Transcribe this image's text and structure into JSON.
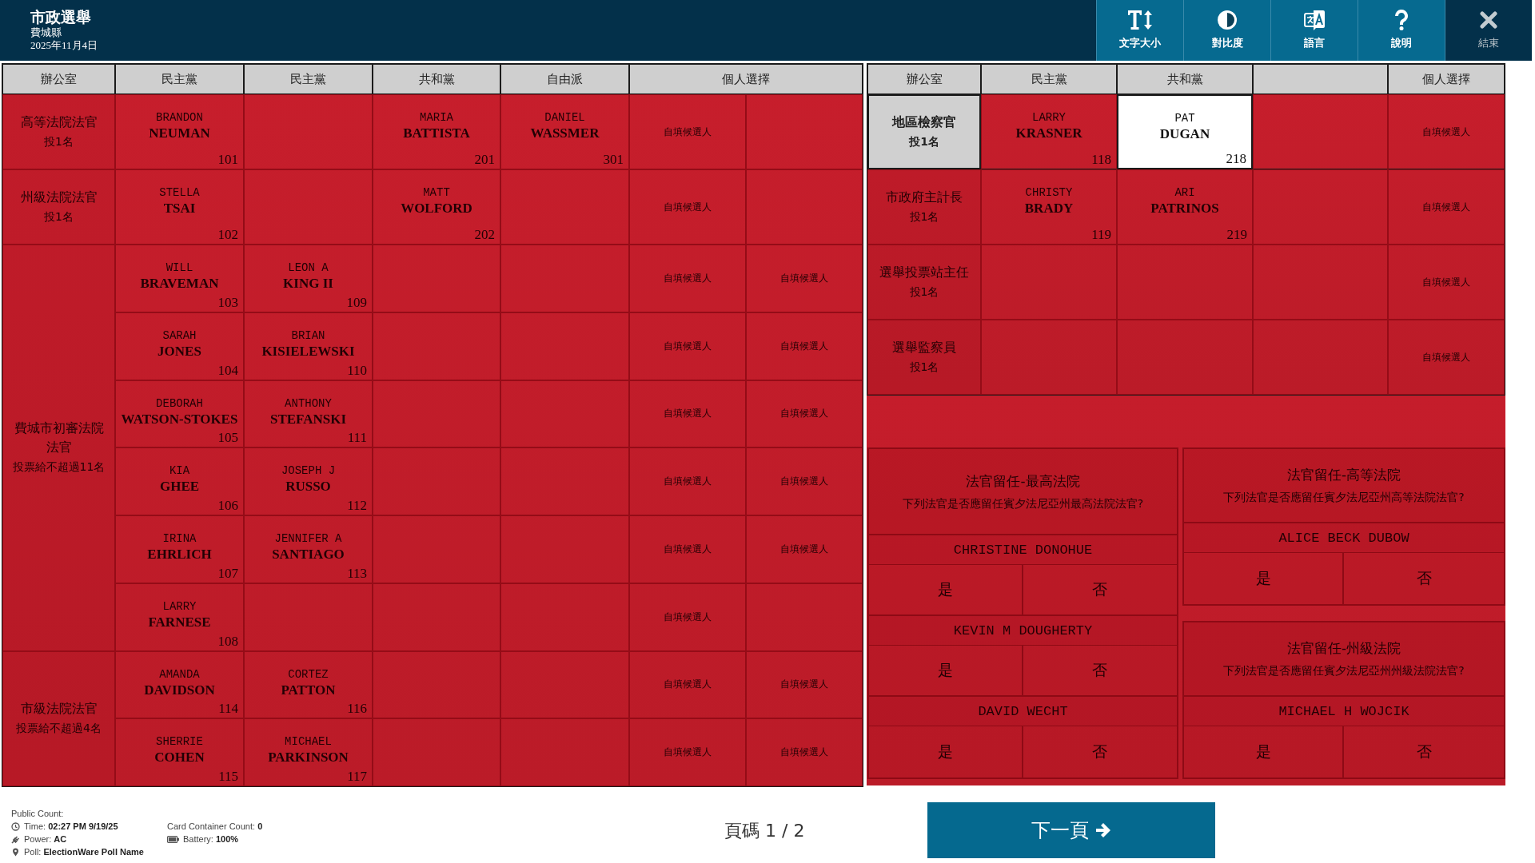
{
  "header": {
    "title": "市政選舉",
    "county": "費城縣",
    "date": "2025年11月4日"
  },
  "toolbar": [
    {
      "kind": "text-size",
      "label": "文字大小"
    },
    {
      "kind": "contrast",
      "label": "對比度"
    },
    {
      "kind": "language",
      "label": "語言"
    },
    {
      "kind": "help",
      "label": "說明"
    },
    {
      "kind": "exit",
      "label": "結束"
    }
  ],
  "left_table": {
    "columns": [
      {
        "label": "辦公室"
      },
      {
        "label": "民主黨"
      },
      {
        "label": "民主黨"
      },
      {
        "label": "共和黨"
      },
      {
        "label": "自由派"
      },
      {
        "label": "個人選擇"
      }
    ],
    "contests": [
      {
        "office": "高等法院法官",
        "limit": "投1名",
        "focused": false,
        "rows": [
          {
            "cells": [
              {
                "kind": "candidate",
                "first": "BRANDON",
                "last": "NEUMAN",
                "number": "101",
                "focused": false
              },
              {
                "kind": "empty"
              },
              {
                "kind": "candidate",
                "first": "MARIA",
                "last": "BATTISTA",
                "number": "201",
                "focused": false
              },
              {
                "kind": "candidate",
                "first": "DANIEL",
                "last": "WASSMER",
                "number": "301",
                "focused": false
              },
              {
                "kind": "write-in",
                "label": "自填候選人"
              },
              {
                "kind": "empty"
              }
            ]
          }
        ]
      },
      {
        "office": "州級法院法官",
        "limit": "投1名",
        "focused": false,
        "rows": [
          {
            "cells": [
              {
                "kind": "candidate",
                "first": "STELLA",
                "last": "TSAI",
                "number": "102",
                "focused": false
              },
              {
                "kind": "empty"
              },
              {
                "kind": "candidate",
                "first": "MATT",
                "last": "WOLFORD",
                "number": "202",
                "focused": false
              },
              {
                "kind": "empty"
              },
              {
                "kind": "write-in",
                "label": "自填候選人"
              },
              {
                "kind": "empty"
              }
            ]
          }
        ]
      },
      {
        "office": "費城市初審法院法官",
        "limit": "投票給不超過11名",
        "focused": false,
        "rows": [
          {
            "cells": [
              {
                "kind": "candidate",
                "first": "WILL",
                "last": "BRAVEMAN",
                "number": "103",
                "focused": false
              },
              {
                "kind": "candidate",
                "first": "LEON A",
                "last": "KING II",
                "number": "109",
                "focused": false
              },
              {
                "kind": "empty"
              },
              {
                "kind": "empty"
              },
              {
                "kind": "write-in",
                "label": "自填候選人"
              },
              {
                "kind": "write-in",
                "label": "自填候選人"
              }
            ]
          },
          {
            "cells": [
              {
                "kind": "candidate",
                "first": "SARAH",
                "last": "JONES",
                "number": "104",
                "focused": false
              },
              {
                "kind": "candidate",
                "first": "BRIAN",
                "last": "KISIELEWSKI",
                "number": "110",
                "focused": false
              },
              {
                "kind": "empty"
              },
              {
                "kind": "empty"
              },
              {
                "kind": "write-in",
                "label": "自填候選人"
              },
              {
                "kind": "write-in",
                "label": "自填候選人"
              }
            ]
          },
          {
            "cells": [
              {
                "kind": "candidate",
                "first": "DEBORAH",
                "last": "WATSON-STOKES",
                "number": "105",
                "focused": false
              },
              {
                "kind": "candidate",
                "first": "ANTHONY",
                "last": "STEFANSKI",
                "number": "111",
                "focused": false
              },
              {
                "kind": "empty"
              },
              {
                "kind": "empty"
              },
              {
                "kind": "write-in",
                "label": "自填候選人"
              },
              {
                "kind": "write-in",
                "label": "自填候選人"
              }
            ]
          },
          {
            "cells": [
              {
                "kind": "candidate",
                "first": "KIA",
                "last": "GHEE",
                "number": "106",
                "focused": false
              },
              {
                "kind": "candidate",
                "first": "JOSEPH J",
                "last": "RUSSO",
                "number": "112",
                "focused": false
              },
              {
                "kind": "empty"
              },
              {
                "kind": "empty"
              },
              {
                "kind": "write-in",
                "label": "自填候選人"
              },
              {
                "kind": "write-in",
                "label": "自填候選人"
              }
            ]
          },
          {
            "cells": [
              {
                "kind": "candidate",
                "first": "IRINA",
                "last": "EHRLICH",
                "number": "107",
                "focused": false
              },
              {
                "kind": "candidate",
                "first": "JENNIFER A",
                "last": "SANTIAGO",
                "number": "113",
                "focused": false
              },
              {
                "kind": "empty"
              },
              {
                "kind": "empty"
              },
              {
                "kind": "write-in",
                "label": "自填候選人"
              },
              {
                "kind": "write-in",
                "label": "自填候選人"
              }
            ]
          },
          {
            "cells": [
              {
                "kind": "candidate",
                "first": "LARRY",
                "last": "FARNESE",
                "number": "108",
                "focused": false
              },
              {
                "kind": "empty"
              },
              {
                "kind": "empty"
              },
              {
                "kind": "empty"
              },
              {
                "kind": "write-in",
                "label": "自填候選人"
              },
              {
                "kind": "empty"
              }
            ]
          }
        ]
      },
      {
        "office": "市級法院法官",
        "limit": "投票給不超過4名",
        "focused": false,
        "rows": [
          {
            "cells": [
              {
                "kind": "candidate",
                "first": "AMANDA",
                "last": "DAVIDSON",
                "number": "114",
                "focused": false
              },
              {
                "kind": "candidate",
                "first": "CORTEZ",
                "last": "PATTON",
                "number": "116",
                "focused": false
              },
              {
                "kind": "empty"
              },
              {
                "kind": "empty"
              },
              {
                "kind": "write-in",
                "label": "自填候選人"
              },
              {
                "kind": "write-in",
                "label": "自填候選人"
              }
            ]
          },
          {
            "cells": [
              {
                "kind": "candidate",
                "first": "SHERRIE",
                "last": "COHEN",
                "number": "115",
                "focused": false
              },
              {
                "kind": "candidate",
                "first": "MICHAEL",
                "last": "PARKINSON",
                "number": "117",
                "focused": false
              },
              {
                "kind": "empty"
              },
              {
                "kind": "empty"
              },
              {
                "kind": "write-in",
                "label": "自填候選人"
              },
              {
                "kind": "write-in",
                "label": "自填候選人"
              }
            ]
          }
        ]
      }
    ]
  },
  "right_table": {
    "columns": [
      {
        "label": "辦公室"
      },
      {
        "label": "民主黨"
      },
      {
        "label": "共和黨"
      },
      {},
      {
        "label": "個人選擇"
      }
    ],
    "contests": [
      {
        "office": "地區檢察官",
        "limit": "投1名",
        "focused": true,
        "rows": [
          {
            "cells": [
              {
                "kind": "candidate",
                "first": "LARRY",
                "last": "KRASNER",
                "number": "118",
                "focused": false
              },
              {
                "kind": "candidate",
                "first": "PAT",
                "last": "DUGAN",
                "number": "218",
                "focused": true
              },
              {
                "kind": "empty"
              },
              {
                "kind": "write-in",
                "label": "自填候選人"
              }
            ]
          }
        ]
      },
      {
        "office": "市政府主計長",
        "limit": "投1名",
        "focused": false,
        "rows": [
          {
            "cells": [
              {
                "kind": "candidate",
                "first": "CHRISTY",
                "last": "BRADY",
                "number": "119",
                "focused": false
              },
              {
                "kind": "candidate",
                "first": "ARI",
                "last": "PATRINOS",
                "number": "219",
                "focused": false
              },
              {
                "kind": "empty"
              },
              {
                "kind": "write-in",
                "label": "自填候選人"
              }
            ]
          }
        ]
      },
      {
        "office": "選舉投票站主任",
        "limit": "投1名",
        "focused": false,
        "rows": [
          {
            "cells": [
              {
                "kind": "empty"
              },
              {
                "kind": "empty"
              },
              {
                "kind": "empty"
              },
              {
                "kind": "write-in",
                "label": "自填候選人"
              }
            ]
          }
        ]
      },
      {
        "office": "選舉監察員",
        "limit": "投1名",
        "focused": false,
        "rows": [
          {
            "cells": [
              {
                "kind": "empty"
              },
              {
                "kind": "empty"
              },
              {
                "kind": "empty"
              },
              {
                "kind": "write-in",
                "label": "自填候選人"
              }
            ]
          }
        ]
      }
    ]
  },
  "retention": {
    "columns": [
      {
        "questions": [
          {
            "title": "法官留任-最高法院",
            "question": "下列法官是否應留任賓夕法尼亞州最高法院法官?",
            "judges": [
              {
                "name": "CHRISTINE DONOHUE",
                "options": [
                  "是",
                  "否"
                ]
              },
              {
                "name": "KEVIN M DOUGHERTY",
                "options": [
                  "是",
                  "否"
                ]
              },
              {
                "name": "DAVID WECHT",
                "options": [
                  "是",
                  "否"
                ]
              }
            ]
          }
        ]
      },
      {
        "questions": [
          {
            "title": "法官留任-高等法院",
            "question": "下列法官是否應留任賓夕法尼亞州高等法院法官?",
            "judges": [
              {
                "name": "ALICE BECK DUBOW",
                "options": [
                  "是",
                  "否"
                ]
              }
            ]
          },
          {
            "title": "法官留任-州級法院",
            "question": "下列法官是否應留任賓夕法尼亞州州級法院法官?",
            "judges": [
              {
                "name": "MICHAEL H WOJCIK",
                "options": [
                  "是",
                  "否"
                ]
              }
            ]
          }
        ]
      }
    ]
  },
  "footer": {
    "status": {
      "heading": "Public Count:",
      "columns": [
        [
          {
            "kind": "clock",
            "text": "Time: **02:27 PM 9/19/25**"
          },
          {
            "kind": "power",
            "text": "Power: **AC**"
          },
          {
            "kind": "location",
            "text": "Poll: **ElectionWare Poll Name**"
          }
        ],
        [
          {
            "kind": "plain",
            "text": "Card Container Count: **0**"
          },
          {
            "kind": "battery",
            "text": "Battery: **100%**"
          }
        ]
      ]
    },
    "page": "頁碼 1 / 2",
    "next": "下一頁"
  }
}
